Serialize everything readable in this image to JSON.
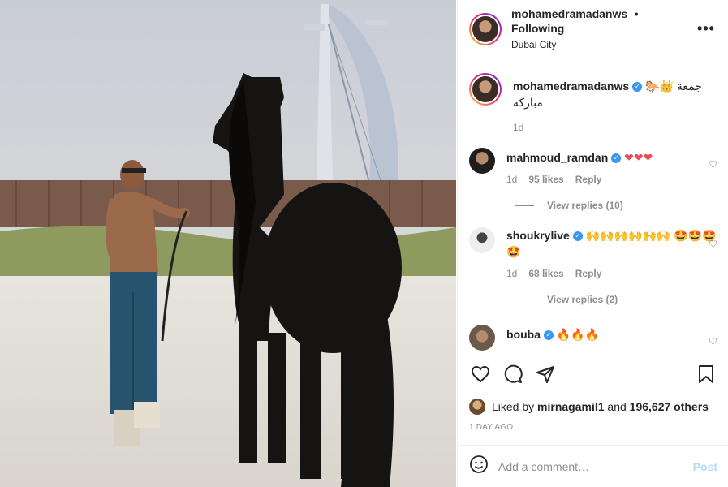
{
  "header": {
    "username": "mohamedramadanws",
    "separator": "•",
    "follow_status": "Following",
    "location": "Dubai City",
    "more": "•••"
  },
  "caption": {
    "username": "mohamedramadanws",
    "text": "🐎👑 جمعة مباركة",
    "time": "1d"
  },
  "comments": [
    {
      "username": "mahmoud_ramdan",
      "text": "❤❤❤",
      "time": "1d",
      "likes": "95 likes",
      "reply": "Reply",
      "view_replies": "View replies (10)"
    },
    {
      "username": "shoukrylive",
      "text": "🙌🙌🙌🙌🙌🙌 🤩🤩🤩🤩",
      "time": "1d",
      "likes": "68 likes",
      "reply": "Reply",
      "view_replies": "View replies (2)"
    },
    {
      "username": "bouba",
      "text": "🔥🔥🔥"
    }
  ],
  "likes": {
    "prefix": "Liked by",
    "user": "mirnagamil1",
    "and": "and",
    "others": "196,627 others"
  },
  "time_ago": "1 DAY AGO",
  "add_comment": {
    "placeholder": "Add a comment…",
    "post_label": "Post"
  },
  "icons": {
    "like": "heart-outline-icon",
    "comment": "speech-bubble-icon",
    "share": "paper-plane-icon",
    "save": "bookmark-icon",
    "emoji": "smiley-icon"
  }
}
